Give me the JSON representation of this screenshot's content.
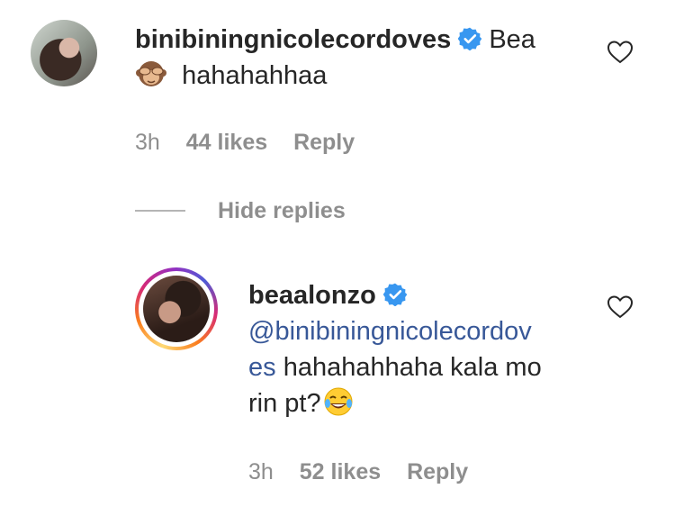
{
  "comment": {
    "username": "binibiningnicolecordoves",
    "text_line1": "Bea",
    "text_line2": "hahahahhaa",
    "time": "3h",
    "likes": "44 likes",
    "reply_label": "Reply",
    "emoji_icon": "see-no-evil-monkey"
  },
  "hide_replies_label": "Hide replies",
  "reply": {
    "username": "beaalonzo",
    "mention_line1": "@binibiningnicolecordov",
    "mention_line2": "es",
    "text_line2": "hahahahhaha kala mo",
    "text_line3": "rin pt?",
    "time": "3h",
    "likes": "52 likes",
    "reply_label": "Reply",
    "emoji_icon": "face-with-tears-of-joy"
  },
  "colors": {
    "text": "#262626",
    "meta": "#8e8e8e",
    "mention": "#385898",
    "verified": "#3897f0"
  }
}
